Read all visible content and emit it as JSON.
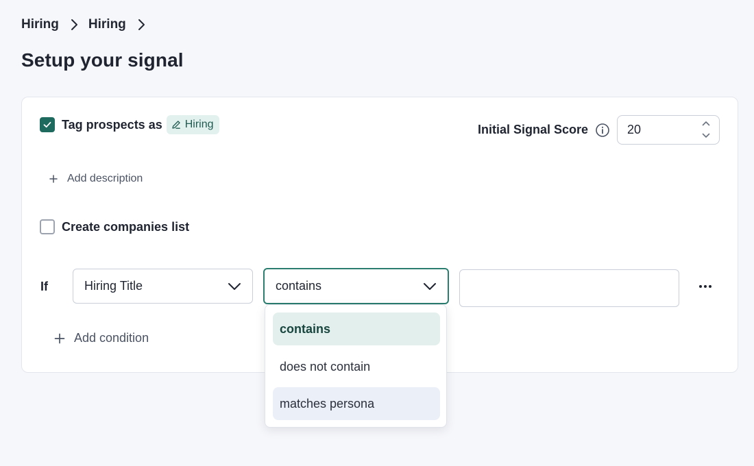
{
  "breadcrumb": [
    {
      "label": "Hiring"
    },
    {
      "label": "Hiring"
    }
  ],
  "page_title": "Setup your signal",
  "tag": {
    "label": "Tag prospects as",
    "chip_label": "Hiring",
    "checked": true
  },
  "score": {
    "label": "Initial Signal Score",
    "value": "20"
  },
  "add_description_label": "Add description",
  "companies_list": {
    "label": "Create companies list",
    "checked": false
  },
  "condition": {
    "if_label": "If",
    "field": "Hiring Title",
    "operator": "contains",
    "value": ""
  },
  "add_condition_label": "Add condition",
  "operator_options": [
    {
      "label": "contains",
      "state": "selected"
    },
    {
      "label": "does not contain",
      "state": "normal"
    },
    {
      "label": "matches persona",
      "state": "hover"
    }
  ],
  "colors": {
    "accent": "#1f6a5e",
    "focus_border": "#2a7d6f",
    "chip_bg": "#e3f1ee",
    "selected_option_bg": "#e3efec",
    "hover_option_bg": "#ebeff7",
    "page_bg": "#f6f7fb"
  },
  "icons": {
    "breadcrumb_separator": "chevron-right-icon",
    "chip": "pencil-icon",
    "score_info": "info-icon",
    "add": "plus-icon",
    "select": "chevron-down-icon",
    "more": "ellipsis-icon",
    "check": "checkmark-icon"
  }
}
